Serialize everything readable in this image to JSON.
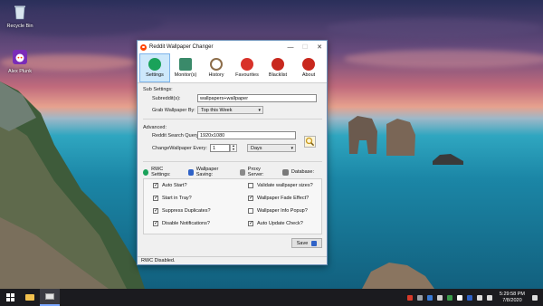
{
  "desktop": {
    "icons": [
      {
        "label": "Recycle Bin"
      },
      {
        "label": "Alex Plunk"
      }
    ]
  },
  "window": {
    "title": "Reddit Wallpaper Changer",
    "controls": {
      "minimize": "—",
      "maximize": "☐",
      "close": "✕"
    },
    "toolbar": [
      {
        "label": "Settings",
        "icon": "gear-icon",
        "color": "#1aa25a"
      },
      {
        "label": "Monitor(s)",
        "icon": "monitor-icon",
        "color": "#3a8a6a"
      },
      {
        "label": "History",
        "icon": "clock-icon",
        "color": "#8c6d4a"
      },
      {
        "label": "Favourites",
        "icon": "heart-icon",
        "color": "#d8322a"
      },
      {
        "label": "Blacklist",
        "icon": "block-icon",
        "color": "#c8281e"
      },
      {
        "label": "About",
        "icon": "info-icon",
        "color": "#c8281e"
      }
    ],
    "sub_settings": {
      "heading": "Sub Settings:",
      "subreddit_label": "Subreddit(s):",
      "subreddit_value": "wallpapers+wallpaper",
      "grab_label": "Grab Wallpaper By:",
      "grab_value": "Top this Week"
    },
    "advanced": {
      "heading": "Advanced:",
      "search_label": "Reddit Search Query:",
      "search_value": "1920x1080",
      "change_label": "ChangeWallpaper Every:",
      "change_value": "1",
      "unit_value": "Days"
    },
    "tabs": [
      {
        "label": "RWC Settings:",
        "color": "#1aa25a"
      },
      {
        "label": "Wallpaper Saving:",
        "color": "#2f62c7"
      },
      {
        "label": "Proxy Server:",
        "color": "#8a8a8a"
      },
      {
        "label": "Database:",
        "color": "#7a7a7a"
      }
    ],
    "checkboxes_left": [
      {
        "label": "Auto Start?",
        "checked": true
      },
      {
        "label": "Start in Tray?",
        "checked": true
      },
      {
        "label": "Suppress Duplicates?",
        "checked": true
      },
      {
        "label": "Disable Notifications?",
        "checked": true
      }
    ],
    "checkboxes_right": [
      {
        "label": "Validate wallpaper sizes?",
        "checked": false
      },
      {
        "label": "Wallpaper Fade Effect?",
        "checked": true
      },
      {
        "label": "Wallpaper Info Popup?",
        "checked": false
      },
      {
        "label": "Auto Update Check?",
        "checked": true
      }
    ],
    "save_label": "Save",
    "status": "RWC Disabled."
  },
  "taskbar": {
    "time": "5:29:58 PM",
    "date": "7/8/2020"
  }
}
